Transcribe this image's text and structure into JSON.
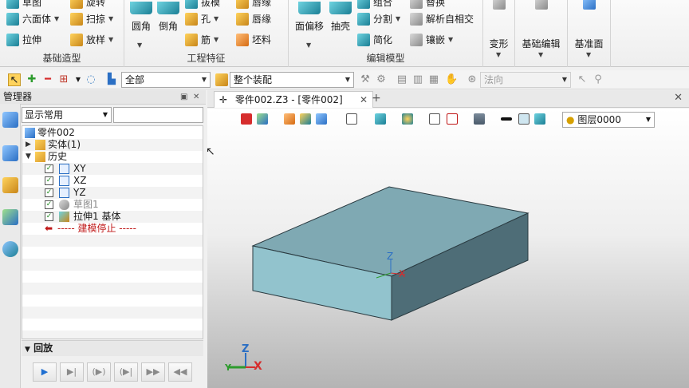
{
  "ribbon": {
    "groups": [
      {
        "label": "基础造型"
      },
      {
        "label": "工程特征"
      },
      {
        "label": "编辑模型"
      },
      {
        "label": "变形"
      },
      {
        "label": "基础编辑"
      },
      {
        "label": "基准面"
      }
    ],
    "basic": {
      "top1": "草图",
      "hexahedron": "六面体",
      "extrude": "拉伸",
      "rotate": "旋转",
      "sweep": "扫掠",
      "loft": "放样"
    },
    "feature": {
      "fillet": "圆角",
      "chamfer": "倒角",
      "ruled": "拔模",
      "hole": "孔",
      "rib": "筋",
      "lip": "唇缘",
      "blank": "坯料"
    },
    "edit": {
      "offset": "面偏移",
      "shell": "抽壳",
      "split": "分割",
      "simplify": "简化",
      "combine": "组合",
      "intersect": "解析自相交",
      "emboss": "镶嵌",
      "replace": "替换"
    }
  },
  "toolbar2": {
    "filter_value": "全部",
    "assembly_value": "整个装配",
    "direction_value": "法向"
  },
  "manager": {
    "title": "管理器",
    "filter_value": "显示常用",
    "tree": [
      {
        "label": "零件002"
      },
      {
        "label": "实体(1)"
      },
      {
        "label": "历史"
      },
      {
        "label": "XY"
      },
      {
        "label": "XZ"
      },
      {
        "label": "YZ"
      },
      {
        "label": "草图1"
      },
      {
        "label": "拉伸1  基体"
      },
      {
        "label": "----- 建模停止 -----"
      }
    ],
    "replay_title": "回放"
  },
  "doc": {
    "tab_label": "零件002.Z3 - [零件002]",
    "layer_value": "图层0000"
  },
  "triad": {
    "x": "X",
    "y": "Y",
    "z": "Z"
  },
  "colors": {
    "box_top": "#7ba7b2",
    "box_front": "#8fc0cb",
    "box_side": "#4f6f78",
    "accent": "#1f6fd1"
  }
}
